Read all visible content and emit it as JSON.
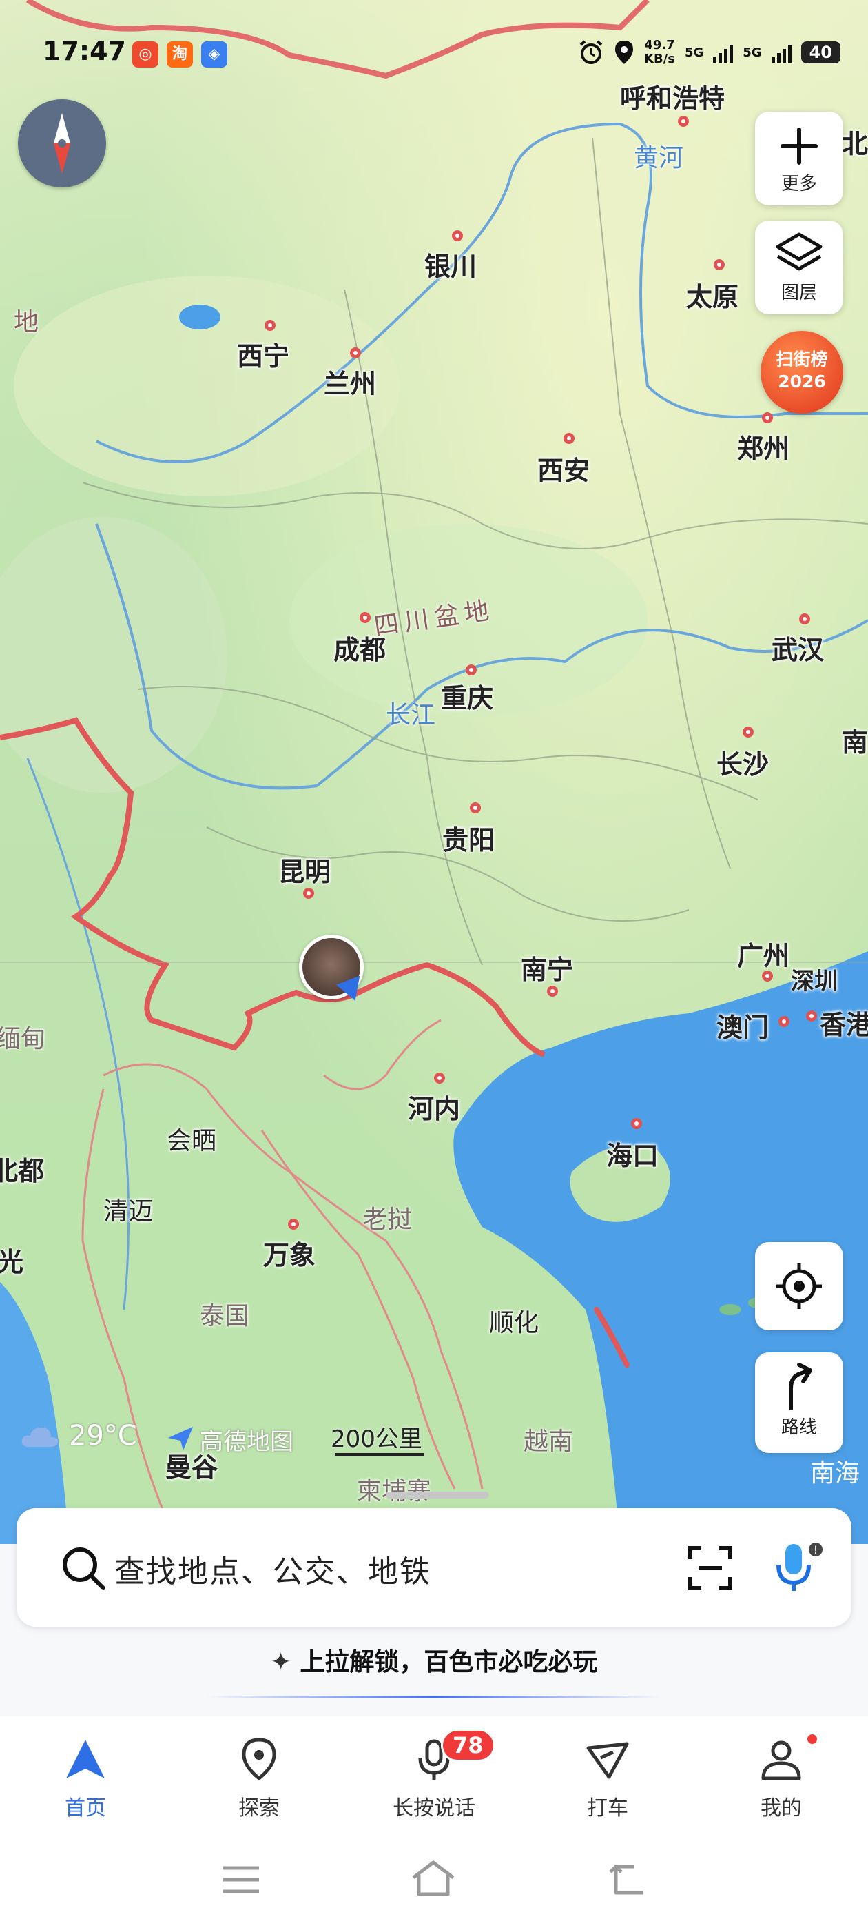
{
  "status_bar": {
    "time": "17:47",
    "apps": [
      {
        "name": "weibo-app-icon",
        "glyph": "◎",
        "color": "#f04a2c"
      },
      {
        "name": "taobao-app-icon",
        "glyph": "淘",
        "color": "#ff6a13"
      },
      {
        "name": "messenger-app-icon",
        "glyph": "◈",
        "color": "#3a7ff0"
      }
    ],
    "net_speed_value": "49.7",
    "net_speed_unit": "KB/s",
    "sim1_label": "5G",
    "sim2_label": "5G",
    "battery": "40"
  },
  "map": {
    "cities": [
      {
        "name": "呼和浩特"
      },
      {
        "name": "银川"
      },
      {
        "name": "太原"
      },
      {
        "name": "西宁"
      },
      {
        "name": "兰州"
      },
      {
        "name": "郑州"
      },
      {
        "name": "西安"
      },
      {
        "name": "成都"
      },
      {
        "name": "武汉"
      },
      {
        "name": "重庆"
      },
      {
        "name": "长沙"
      },
      {
        "name": "贵阳"
      },
      {
        "name": "昆明"
      },
      {
        "name": "南宁"
      },
      {
        "name": "广州"
      },
      {
        "name": "深圳"
      },
      {
        "name": "澳门"
      },
      {
        "name": "香港"
      },
      {
        "name": "河内"
      },
      {
        "name": "海口"
      },
      {
        "name": "会晒"
      },
      {
        "name": "清迈"
      },
      {
        "name": "万象"
      },
      {
        "name": "顺化"
      },
      {
        "name": "曼谷"
      }
    ],
    "partial_labels": {
      "north_cut": "北",
      "nan_cut": "南",
      "bei_cut": "北都",
      "guang_cut": "光",
      "di_cut": "地",
      "myanmar": "缅甸"
    },
    "regions": {
      "sichuan_basin": "四川盆地"
    },
    "rivers": {
      "yellow": "黄河",
      "yangtze": "长江"
    },
    "countries": {
      "laos": "老挝",
      "thailand": "泰国",
      "vietnam": "越南",
      "cambodia": "柬埔寨"
    },
    "sea": "南海",
    "weather": {
      "temp": "29°C"
    },
    "attribution": "高德地图",
    "scale": "200公里"
  },
  "controls": {
    "more_label": "更多",
    "layers_label": "图层",
    "promo_line1": "扫街榜",
    "promo_line2": "2026",
    "route_label": "路线"
  },
  "search": {
    "placeholder": "查找地点、公交、地铁"
  },
  "promo_text": "上拉解锁，百色市必吃必玩",
  "tabs": [
    {
      "label": "首页"
    },
    {
      "label": "探索"
    },
    {
      "label": "长按说话",
      "badge": "78"
    },
    {
      "label": "打车"
    },
    {
      "label": "我的"
    }
  ],
  "colors": {
    "accent": "#2f6fe6",
    "border_red": "#e05252",
    "sea": "#4da0e8"
  }
}
